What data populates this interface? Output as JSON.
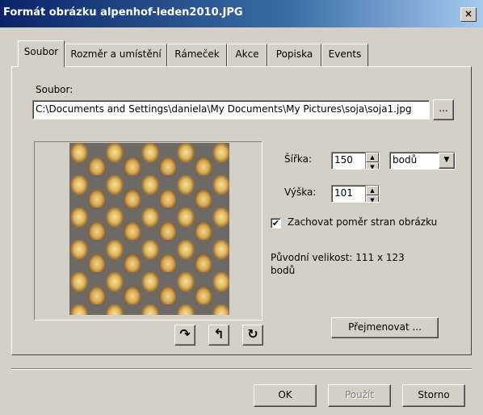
{
  "window": {
    "title": "Formát obrázku alpenhof-leden2010.JPG",
    "close_glyph": "×"
  },
  "tabs": [
    {
      "label": "Soubor",
      "active": true
    },
    {
      "label": "Rozměr a umístění",
      "active": false
    },
    {
      "label": "Rámeček",
      "active": false
    },
    {
      "label": "Akce",
      "active": false
    },
    {
      "label": "Popiska",
      "active": false
    },
    {
      "label": "Events",
      "active": false
    }
  ],
  "file": {
    "label": "Soubor:",
    "path": "C:\\Documents and Settings\\daniela\\My Documents\\My Pictures\\soja\\soja1.jpg",
    "browse_label": "..."
  },
  "preview": {
    "description_icon": "soybeans-image"
  },
  "rotate_buttons": [
    {
      "glyph": "↷",
      "icon": "rotate-right-icon"
    },
    {
      "glyph": "↰",
      "icon": "flip-icon"
    },
    {
      "glyph": "↻",
      "icon": "rotate-icon"
    }
  ],
  "size": {
    "width_label": "Šířka:",
    "width_value": "150",
    "unit_value": "bodů",
    "height_label": "Výška:",
    "height_value": "101"
  },
  "keep_ratio": {
    "label": "Zachovat poměr stran obrázku",
    "checked": true,
    "mark": "✔"
  },
  "original_size": {
    "text": "Původní velikost: 111 x 123",
    "unit": "bodů"
  },
  "rename_button": "Přejmenovat ...",
  "footer": {
    "ok": "OK",
    "apply": "Použít",
    "cancel": "Storno"
  }
}
